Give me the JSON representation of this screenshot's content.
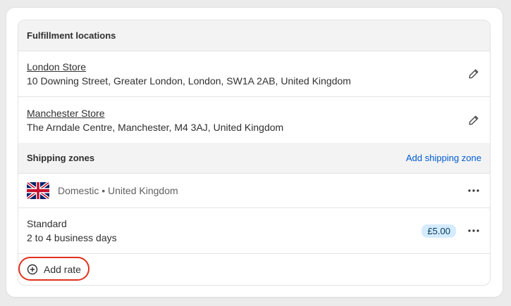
{
  "fulfillment": {
    "heading": "Fulfillment locations",
    "locations": [
      {
        "name": "London Store",
        "address": "10 Downing Street, Greater London, London, SW1A 2AB, United Kingdom"
      },
      {
        "name": "Manchester Store",
        "address": "The Arndale Centre, Manchester, M4 3AJ, United Kingdom"
      }
    ]
  },
  "shipping": {
    "heading": "Shipping zones",
    "add_zone_label": "Add shipping zone",
    "zone": {
      "label": "Domestic • United Kingdom",
      "flag_icon": "uk-flag-icon"
    },
    "rate": {
      "name": "Standard",
      "delivery": "2 to 4 business days",
      "price": "£5.00"
    },
    "add_rate_label": "Add rate"
  },
  "colors": {
    "link": "#005bd3",
    "highlight": "#e0301e",
    "price_badge_bg": "#d5ebff"
  }
}
